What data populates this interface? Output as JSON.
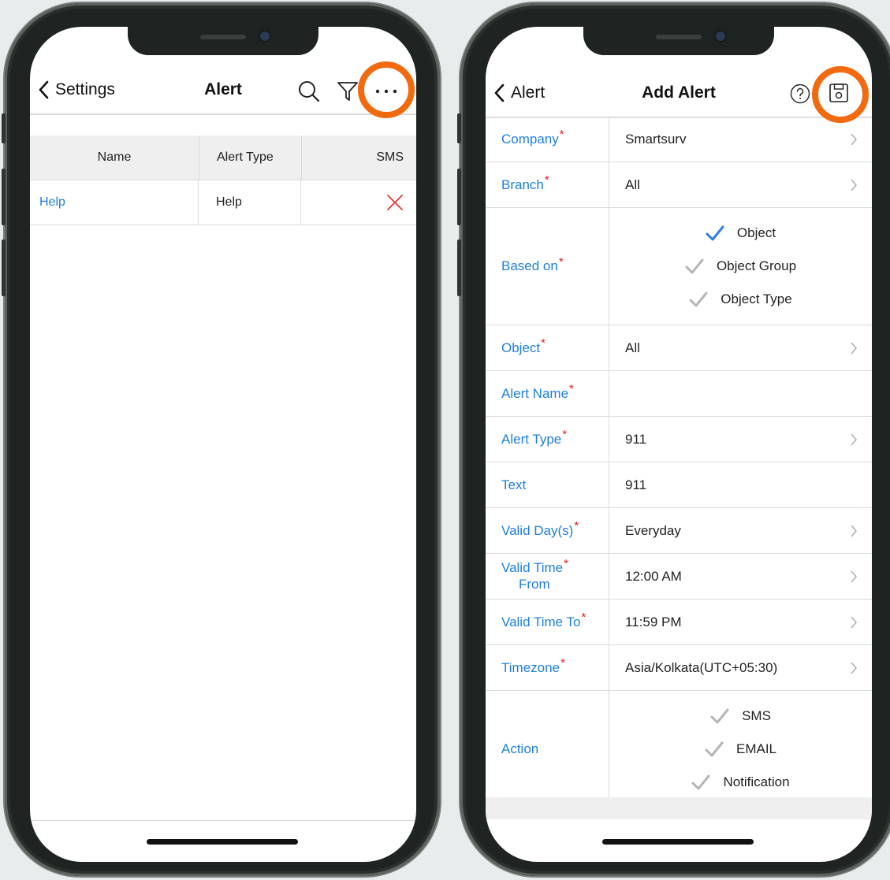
{
  "left_screen": {
    "nav": {
      "back_label": "Settings",
      "title": "Alert"
    },
    "icons": [
      "search-icon",
      "filter-icon",
      "more-icon"
    ],
    "table": {
      "headers": [
        "Name",
        "Alert Type",
        "SMS"
      ],
      "rows": [
        {
          "name": "Help",
          "alert_type": "Help",
          "sms": "x"
        }
      ]
    }
  },
  "right_screen": {
    "nav": {
      "back_label": "Alert",
      "title": "Add Alert"
    },
    "icons": [
      "help-icon",
      "save-icon"
    ],
    "fields": {
      "company": {
        "label": "Company",
        "value": "Smartsurv"
      },
      "branch": {
        "label": "Branch",
        "value": "All"
      },
      "based_on": {
        "label": "Based on",
        "options": [
          "Object",
          "Object Group",
          "Object Type"
        ],
        "selected": "Object"
      },
      "object": {
        "label": "Object",
        "value": "All"
      },
      "alert_name": {
        "label": "Alert Name",
        "value": ""
      },
      "alert_type": {
        "label": "Alert Type",
        "value": "911"
      },
      "text": {
        "label": "Text",
        "value": "911"
      },
      "valid_days": {
        "label": "Valid Day(s)",
        "value": "Everyday"
      },
      "valid_time_from": {
        "label_line1": "Valid Time",
        "label_line2": "From",
        "value": "12:00 AM"
      },
      "valid_time_to": {
        "label": "Valid Time To",
        "value": "11:59 PM"
      },
      "timezone": {
        "label": "Timezone",
        "value": "Asia/Kolkata(UTC+05:30)"
      },
      "action": {
        "label": "Action",
        "options": [
          "SMS",
          "EMAIL",
          "Notification"
        ]
      }
    },
    "required_mark": "*"
  },
  "colors": {
    "accent_blue": "#1f7fe0",
    "required_red": "#e21b1b",
    "highlight_orange": "#f26a10",
    "check_gray": "#b5b5b5"
  }
}
